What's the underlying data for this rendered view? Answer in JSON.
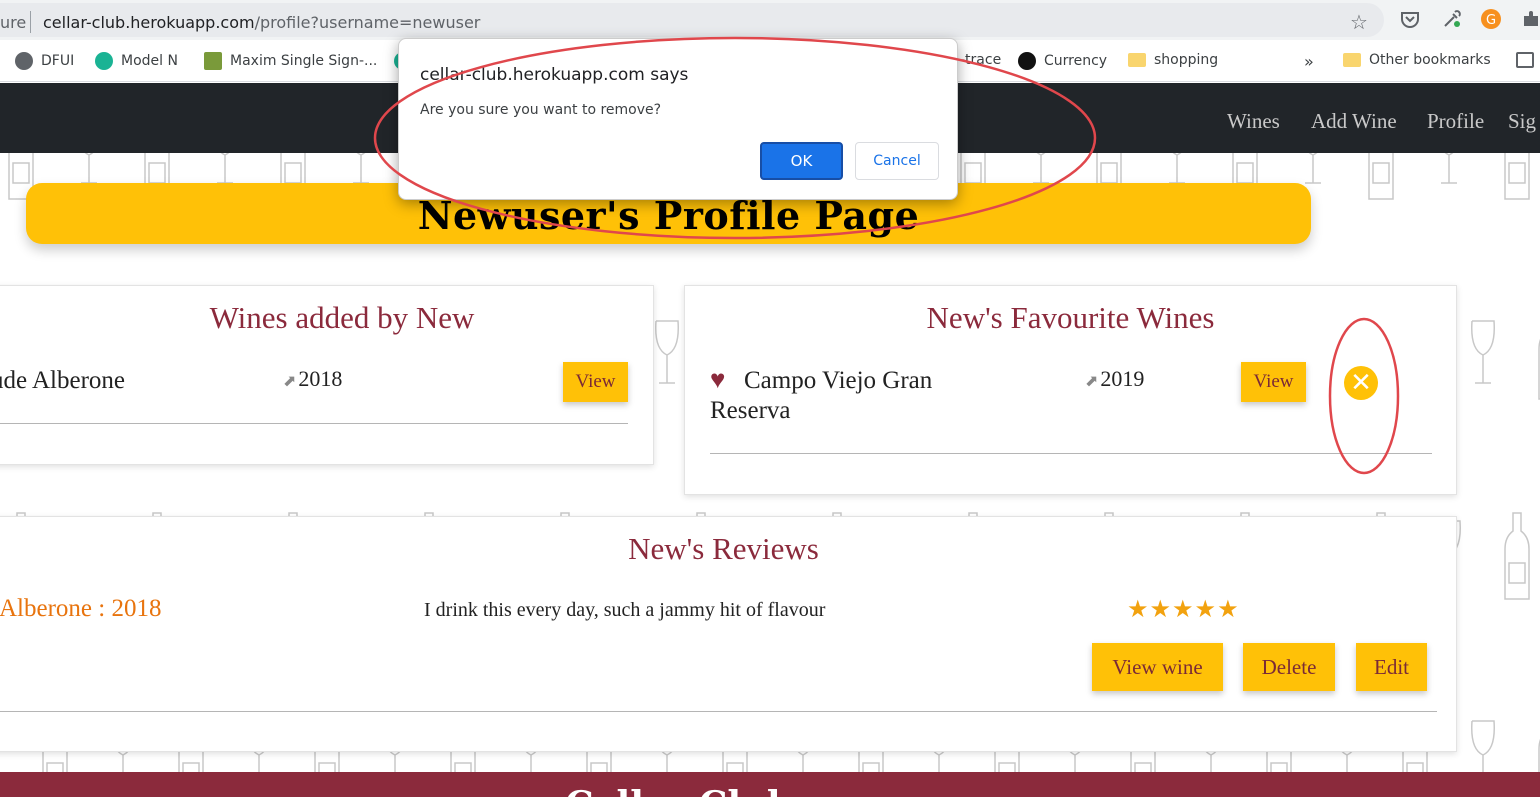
{
  "browser": {
    "url_prefix": "ure",
    "url_host": "cellar-club.herokuapp.com",
    "url_path": "/profile?username=newuser",
    "bookmarks": [
      {
        "label": "DFUI"
      },
      {
        "label": "Model N"
      },
      {
        "label": "Maxim Single Sign-..."
      },
      {
        "label": "-trace"
      },
      {
        "label": "Currency"
      },
      {
        "label": "shopping"
      }
    ],
    "overflow_label": "»",
    "other_bookmarks": "Other bookmarks"
  },
  "nav": {
    "links": [
      "Wines",
      "Add Wine",
      "Profile",
      "Sig"
    ]
  },
  "banner": {
    "title": "Newuser's Profile Page"
  },
  "wines_added": {
    "title": "Wines added by New",
    "items": [
      {
        "name": "ude Alberone",
        "year": "2018",
        "view_label": "View"
      }
    ]
  },
  "favourites": {
    "title": "New's Favourite Wines",
    "items": [
      {
        "name_line1": "Campo Viejo Gran",
        "name_line2": "Reserva",
        "year": "2019",
        "view_label": "View"
      }
    ]
  },
  "reviews": {
    "title": "New's Reviews",
    "items": [
      {
        "wine": "Alberone : 2018",
        "text": "I drink this every day, such a jammy hit of flavour",
        "stars": "★★★★★",
        "rating": 5,
        "view_label": "View wine",
        "delete_label": "Delete",
        "edit_label": "Edit"
      }
    ]
  },
  "footer": {
    "text": "Cellar Club"
  },
  "dialog": {
    "origin": "cellar-club.herokuapp.com says",
    "message": "Are you sure you want to remove?",
    "ok_label": "OK",
    "cancel_label": "Cancel"
  },
  "colors": {
    "accent": "#ffc107",
    "wine": "#8b2a3c",
    "annotation": "#e0474c"
  }
}
